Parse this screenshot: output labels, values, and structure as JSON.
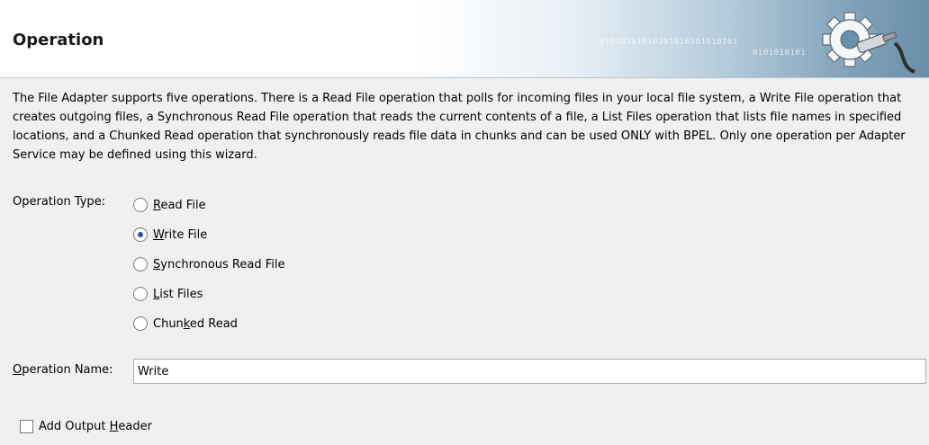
{
  "header": {
    "title": "Operation",
    "binary_line1": "01010101010101010101010101",
    "binary_line2": "0101010101"
  },
  "description": "The File Adapter supports five operations.  There is a Read File operation that polls for incoming files in your local file system, a Write File operation that creates outgoing files, a Synchronous Read File operation that reads the current contents of a file, a List Files operation that lists file names in specified locations, and a Chunked Read operation that synchronously reads file data in chunks and can be used ONLY with BPEL. Only one operation per Adapter Service may be defined using this wizard.",
  "operation_type": {
    "label": "Operation Type:",
    "selected": "Write File",
    "options": [
      {
        "pre": "",
        "mn": "R",
        "post": "ead File"
      },
      {
        "pre": "",
        "mn": "W",
        "post": "rite File"
      },
      {
        "pre": "",
        "mn": "S",
        "post": "ynchronous Read File"
      },
      {
        "pre": "",
        "mn": "L",
        "post": "ist Files"
      },
      {
        "pre": "Chun",
        "mn": "k",
        "post": "ed Read"
      }
    ]
  },
  "operation_name": {
    "label_mn": "O",
    "label_rest": "peration Name:",
    "value": "Write"
  },
  "output_header": {
    "pre": "Add Output ",
    "mn": "H",
    "post": "eader",
    "checked": false
  },
  "colors": {
    "radio_dot": "#2b4f9c",
    "header_gradient_end": "#6b8fa9"
  }
}
